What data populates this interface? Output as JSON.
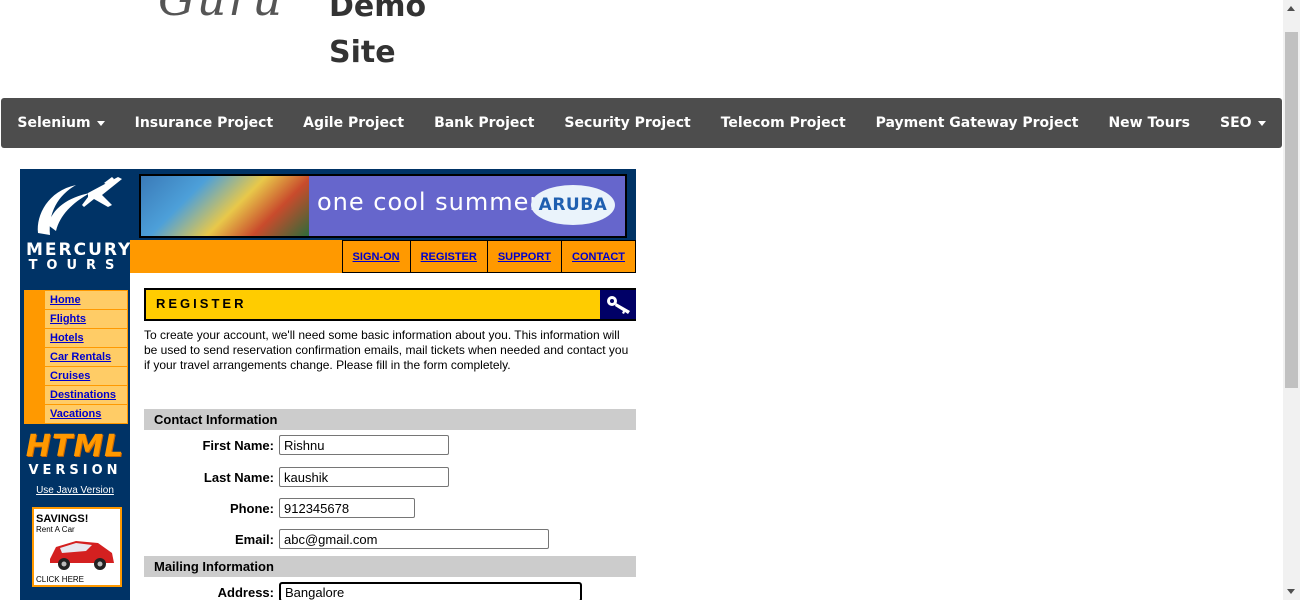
{
  "header": {
    "logo_fragment": "Guru",
    "site_title_line1": "Demo",
    "site_title_line2": "Site"
  },
  "nav": {
    "items": [
      {
        "label": "Selenium",
        "dropdown": true
      },
      {
        "label": "Insurance Project",
        "dropdown": false
      },
      {
        "label": "Agile Project",
        "dropdown": false
      },
      {
        "label": "Bank Project",
        "dropdown": false
      },
      {
        "label": "Security Project",
        "dropdown": false
      },
      {
        "label": "Telecom Project",
        "dropdown": false
      },
      {
        "label": "Payment Gateway Project",
        "dropdown": false
      },
      {
        "label": "New Tours",
        "dropdown": false
      },
      {
        "label": "SEO",
        "dropdown": true
      }
    ]
  },
  "mercury": {
    "brand_line1": "MERCURY",
    "brand_line2": "TOURS",
    "side_menu": [
      "Home",
      "Flights",
      "Hotels",
      "Car Rentals",
      "Cruises",
      "Destinations",
      "Vacations"
    ],
    "html_version_line1": "HTML",
    "html_version_line2": "VERSION",
    "java_link": "Use Java Version",
    "savings_title": "SAVINGS!",
    "savings_sub": "Rent A Car",
    "savings_click": "CLICK HERE",
    "banner_text": "one cool summer",
    "banner_logo": "ARUBA",
    "top_links": [
      "SIGN-ON",
      "REGISTER",
      "SUPPORT",
      "CONTACT"
    ],
    "register_title": "REGISTER",
    "intro_text": "To create your account, we'll need some basic information about you. This information will be used to send reservation confirmation emails, mail tickets when needed and contact you if your travel arrangements change. Please fill in the form completely."
  },
  "contact_section": {
    "title": "Contact Information",
    "first_name_label": "First Name:",
    "first_name_value": "Rishnu",
    "last_name_label": "Last Name:",
    "last_name_value": "kaushik",
    "phone_label": "Phone:",
    "phone_value": "912345678",
    "email_label": "Email:",
    "email_value": "abc@gmail.com"
  },
  "mailing_section": {
    "title": "Mailing Information",
    "address_label": "Address:",
    "address_value": "Bangalore"
  },
  "colors": {
    "navbar": "#4d4d4d",
    "mercury_navy": "#003366",
    "mercury_orange": "#ff9900",
    "register_yellow": "#ffcc00",
    "section_gray": "#cccccc",
    "link_blue": "#0000cc"
  }
}
